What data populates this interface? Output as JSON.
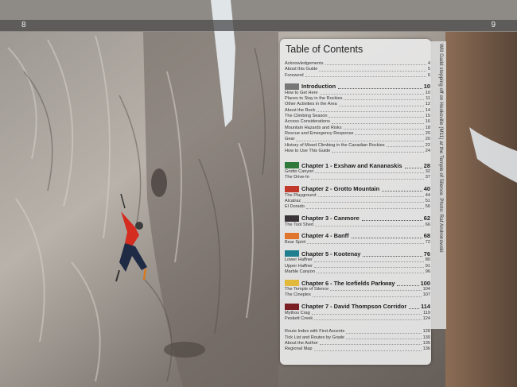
{
  "page_numbers": {
    "left": "8",
    "right": "9"
  },
  "photo_caption": "Will Gadd stepping off on Hooksville (M11) at the Temple of Silence. Photo: Raf Andronowski",
  "toc": {
    "title": "Table of Contents",
    "front_matter": [
      {
        "label": "Acknowledgements",
        "page": "4"
      },
      {
        "label": "About this Guide",
        "page": "5"
      },
      {
        "label": "Foreword",
        "page": "6"
      }
    ],
    "introduction": {
      "label": "Introduction",
      "page": "10",
      "color": "#777777",
      "items": [
        {
          "label": "How to Get Here",
          "page": "10"
        },
        {
          "label": "Places to Stay in the Rockies",
          "page": "11"
        },
        {
          "label": "Other Activities in the Area",
          "page": "12"
        },
        {
          "label": "About the Rock",
          "page": "14"
        },
        {
          "label": "The Climbing Season",
          "page": "15"
        },
        {
          "label": "Access Considerations",
          "page": "16"
        },
        {
          "label": "Mountain Hazards and Risks",
          "page": "18"
        },
        {
          "label": "Rescue and Emergency Response",
          "page": "20"
        },
        {
          "label": "Gear",
          "page": "20"
        },
        {
          "label": "History of Mixed Climbing in the Canadian Rockies",
          "page": "22"
        },
        {
          "label": "How to Use This Guide",
          "page": "24"
        }
      ]
    },
    "chapters": [
      {
        "label": "Chapter 1 - Exshaw and Kananaskis",
        "page": "28",
        "color": "#2f7a3a",
        "items": [
          {
            "label": "Grotto Canyon",
            "page": "32"
          },
          {
            "label": "The Drive-In",
            "page": "37"
          }
        ]
      },
      {
        "label": "Chapter 2 - Grotto Mountain",
        "page": "40",
        "color": "#c0392b",
        "items": [
          {
            "label": "The Playground",
            "page": "44"
          },
          {
            "label": "Alcatraz",
            "page": "51"
          },
          {
            "label": "El Dorado",
            "page": "56"
          }
        ]
      },
      {
        "label": "Chapter 3 - Canmore",
        "page": "62",
        "color": "#3a3338",
        "items": [
          {
            "label": "The Tool Shed",
            "page": "66"
          }
        ]
      },
      {
        "label": "Chapter 4 - Banff",
        "page": "68",
        "color": "#e0762d",
        "items": [
          {
            "label": "Bear Spirit",
            "page": "72"
          }
        ]
      },
      {
        "label": "Chapter 5 - Kootenay",
        "page": "76",
        "color": "#1f7f8f",
        "items": [
          {
            "label": "Lower Haffner",
            "page": "80"
          },
          {
            "label": "Upper Haffner",
            "page": "91"
          },
          {
            "label": "Marble Canyon",
            "page": "96"
          }
        ]
      },
      {
        "label": "Chapter 6 - The Icefields Parkway",
        "page": "100",
        "color": "#e2b93b",
        "items": [
          {
            "label": "The Temple of Silence",
            "page": "104"
          },
          {
            "label": "The Cineplex",
            "page": "107"
          }
        ]
      },
      {
        "label": "Chapter 7 - David Thompson Corridor",
        "page": "114",
        "color": "#7a1f24",
        "items": [
          {
            "label": "Mythos Crag",
            "page": "119"
          },
          {
            "label": "Peskett Creek",
            "page": "124"
          }
        ]
      }
    ],
    "back_matter": [
      {
        "label": "Route Index with First Ascents",
        "page": "128"
      },
      {
        "label": "Tick List and Routes by Grade",
        "page": "130"
      },
      {
        "label": "About the Author",
        "page": "135"
      },
      {
        "label": "Regional Map",
        "page": "136"
      }
    ]
  }
}
